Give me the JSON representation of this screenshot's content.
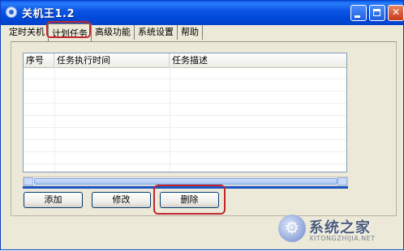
{
  "window": {
    "title": "关机王1.2",
    "icon": "app-shutdown-icon"
  },
  "title_buttons": {
    "minimize": "minimize-icon",
    "maximize": "maximize-icon",
    "close": "✕"
  },
  "tabs": [
    {
      "label": "定时关机",
      "active": false
    },
    {
      "label": "计划任务",
      "active": true
    },
    {
      "label": "高级功能",
      "active": false
    },
    {
      "label": "系统设置",
      "active": false
    },
    {
      "label": "帮助",
      "active": false
    }
  ],
  "table": {
    "columns": [
      "序号",
      "任务执行时间",
      "任务描述"
    ],
    "rows": []
  },
  "buttons": {
    "add": "添加",
    "edit": "修改",
    "delete": "删除"
  },
  "watermark": {
    "text": "系统之家",
    "sub": "XITONGZHIJIA.NET"
  },
  "colors": {
    "titlebar": "#0a55e6",
    "highlight": "#c1272d",
    "accent_line": "#1b55c8"
  }
}
